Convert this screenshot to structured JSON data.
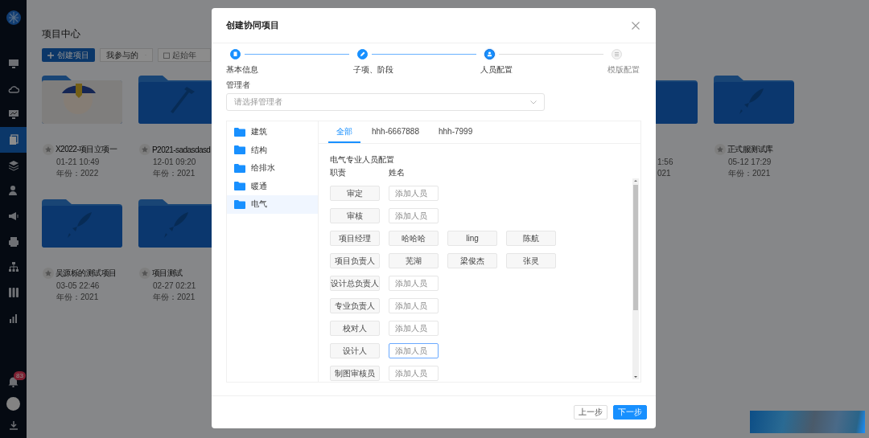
{
  "sidebar": {
    "items": [
      {
        "selected": false
      },
      {
        "selected": false
      },
      {
        "selected": false
      },
      {
        "selected": true
      },
      {
        "selected": false
      },
      {
        "selected": false
      },
      {
        "selected": false
      },
      {
        "selected": false
      },
      {
        "selected": false
      },
      {
        "selected": false
      },
      {
        "selected": false
      }
    ],
    "notification_badge": "83"
  },
  "main": {
    "title": "项目中心",
    "create_button": "创建项目",
    "filter_dropdown": "我参与的",
    "year_field": {
      "placeholder": "起始年"
    },
    "project_rows": [
      {
        "left": [
          {
            "kind": "photo",
            "title": "X2022-项目立项一",
            "date": "01-21 10:49",
            "year": "年份：2022"
          },
          {
            "kind": "hammer",
            "title": "P2021-sadasdasd",
            "date": "12-01 09:20",
            "year": "年份：2021"
          }
        ],
        "right": [
          {
            "kind": "partial",
            "date": "1:56",
            "year": "021"
          },
          {
            "kind": "rocket",
            "title": "正式服测试库",
            "date": "05-12 17:29",
            "year": "年份：2021"
          }
        ]
      },
      {
        "left": [
          {
            "kind": "rocket",
            "title": "吴源栎的测试项目",
            "date": "03-05 22:46",
            "year": "年份：2021"
          },
          {
            "kind": "rocket",
            "title": "项目测试",
            "date": "02-27 02:21",
            "year": "年份：2021"
          }
        ],
        "right": []
      }
    ]
  },
  "dialog": {
    "title": "创建协同项目",
    "steps": [
      {
        "label": "基本信息",
        "completed": true,
        "selected": false
      },
      {
        "label": "子项、阶段",
        "completed": true,
        "selected": false
      },
      {
        "label": "人员配置",
        "completed": false,
        "selected": true
      },
      {
        "label": "模版配置",
        "completed": false,
        "selected": false
      }
    ],
    "manager": {
      "label": "管理者",
      "placeholder": "请选择管理者"
    },
    "categories": [
      {
        "label": "建筑",
        "selected": false
      },
      {
        "label": "结构",
        "selected": false
      },
      {
        "label": "给排水",
        "selected": false
      },
      {
        "label": "暖通",
        "selected": false
      },
      {
        "label": "电气",
        "selected": true
      }
    ],
    "tabs": [
      {
        "label": "全部",
        "selected": true
      },
      {
        "label": "hhh-6667888",
        "selected": false
      },
      {
        "label": "hhh-7999",
        "selected": false
      }
    ],
    "staff": {
      "heading": "电气专业人员配置",
      "role_column": "职责",
      "name_column": "姓名",
      "rows": [
        {
          "role": "审定",
          "add_field": {
            "placeholder": "添加人员",
            "focused": false
          }
        },
        {
          "role": "审核",
          "add_field": {
            "placeholder": "添加人员",
            "focused": false
          }
        },
        {
          "role": "项目经理",
          "members": [
            "哈哈哈",
            "ling",
            "陈航"
          ]
        },
        {
          "role": "项目负责人",
          "members": [
            "芜湖",
            "梁俊杰",
            "张灵"
          ]
        },
        {
          "role": "设计总负责人",
          "add_field": {
            "placeholder": "添加人员",
            "focused": false
          }
        },
        {
          "role": "专业负责人",
          "add_field": {
            "placeholder": "添加人员",
            "focused": false
          }
        },
        {
          "role": "校对人",
          "add_field": {
            "placeholder": "添加人员",
            "focused": false
          }
        },
        {
          "role": "设计人",
          "add_field": {
            "placeholder": "添加人员",
            "focused": true
          }
        },
        {
          "role": "制图审核员",
          "add_field": {
            "placeholder": "添加人员",
            "focused": false
          }
        }
      ]
    },
    "buttons": {
      "previous": "上一步",
      "next": "下一步"
    }
  }
}
